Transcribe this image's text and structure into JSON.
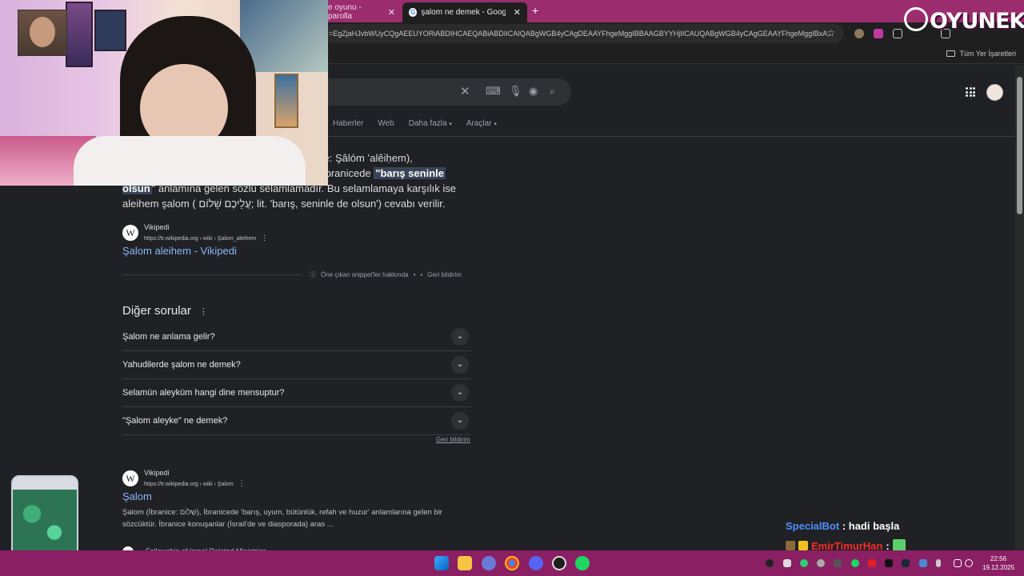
{
  "browser": {
    "tabs": [
      {
        "title": "e oyunu - parolla",
        "active": false
      },
      {
        "title": "şalom ne demek - Google'da A",
        "active": true
      }
    ],
    "new_tab_symbol": "+",
    "close_symbol": "✕",
    "url": "=EgZjaHJvbWUyCQgAEEUYORiABDIHCAEQABiABDIICAIQABgWGB4yCAgDEAAYFhgeMggIBBAAGBYYHjIICAUQABgWGB4yCAgGEAAYFhgeMggIBxA...",
    "bookmarks_all": "Tüm Yer İşaretleri",
    "accent_color": "#9b2d6f"
  },
  "logo": {
    "text": "OYUNEKS"
  },
  "google": {
    "nav_tabs": [
      "Haberler",
      "Web",
      "Daha fazla",
      "Araçlar"
    ],
    "snippet": {
      "line1": "ze: Şâlóm ʻalêiḥem),",
      "line2_pre": "İbranicede ",
      "highlight_a": "\"barış seninle",
      "highlight_b": "olsun",
      "line3_post": "\" anlamına gelen sözlü selamlamadır. Bu selamlamaya karşılık ise",
      "line4": "aleihem şalom ( עֲלֵיכֶם שָׁלוֹם; lit. 'barış, seninle de olsun') cevabı verilir."
    },
    "source1": {
      "name": "Vikipedi",
      "url": "https://tr.wikipedia.org › wiki › Şalom_aleihem",
      "title": "Şalom aleihem - Vikipedi"
    },
    "featured_about": "Öne çıkan snippet'ler hakkında",
    "feedback": "Geri bildirim",
    "paa_title": "Diğer sorular",
    "questions": [
      "Şalom ne anlama gelir?",
      "Yahudilerde şalom ne demek?",
      "Selamün aleyküm hangi dine mensuptur?",
      "\"Şalom aleyke\" ne demek?"
    ],
    "feedback2": "Geri bildirim",
    "source2": {
      "name": "Vikipedi",
      "url": "https://tr.wikipedia.org › wiki › Şalom",
      "title": "Şalom",
      "desc": "Şalom (İbranice: שָׁלוֹם), İbranicede 'barış, uyum, bütünlük, refah ve huzur' anlamlarına gelen bir sözcüktür. İbranice konuşanlar (İsrail'de ve diasporada) aras ..."
    },
    "source3_partial": "Fellowship of Israel Related Ministries"
  },
  "chat": [
    {
      "user": "SpecialBot",
      "sep": " : ",
      "msg": "hadi başla"
    },
    {
      "user": "EmirTimurHan",
      "sep": " :",
      "msg": ""
    }
  ],
  "clock": {
    "time": "22:56",
    "date": "19.12.2025"
  }
}
